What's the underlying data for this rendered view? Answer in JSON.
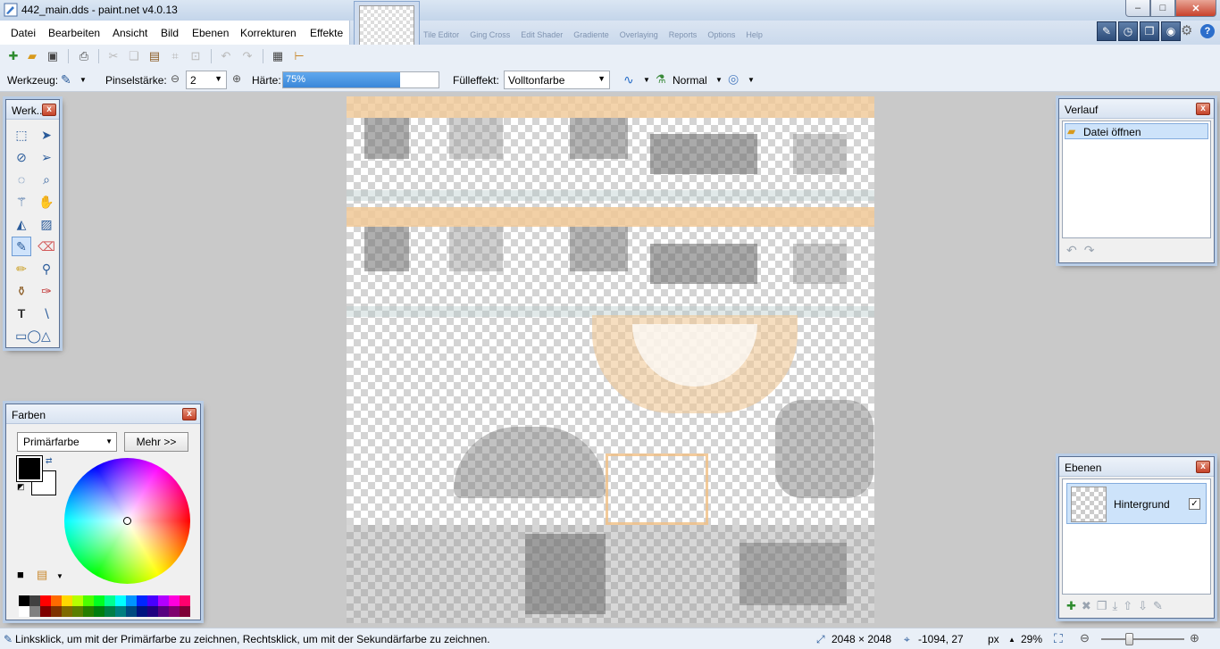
{
  "window": {
    "title": "442_main.dds - paint.net v4.0.13",
    "minimize": "–",
    "maximize": "□",
    "close": "✕"
  },
  "menu": [
    "Datei",
    "Bearbeiten",
    "Ansicht",
    "Bild",
    "Ebenen",
    "Korrekturen",
    "Effekte"
  ],
  "faded_menu": [
    "Tile Editor",
    "Ging Cross",
    "Edit Shader",
    "Gradiente",
    "Overlaying",
    "Reports",
    "Options",
    "Help"
  ],
  "toolbar": {
    "icons": [
      "new-icon",
      "open-icon",
      "save-icon",
      "print-icon",
      "cut-icon",
      "copy-icon",
      "paste-icon",
      "crop-icon",
      "deselect-icon",
      "undo-icon",
      "redo-icon",
      "grid-icon",
      "ruler-icon"
    ]
  },
  "options": {
    "tool_label": "Werkzeug:",
    "brush_width_label": "Pinselstärke:",
    "brush_width_value": "2",
    "hardness_label": "Härte:",
    "hardness_value": "75%",
    "hardness_fraction": 0.75,
    "fill_label": "Fülleffekt:",
    "fill_value": "Volltonfarbe",
    "blend_value": "Normal"
  },
  "tools_panel": {
    "title": "Werk...",
    "close": "x",
    "tools": [
      "rectangle-select",
      "move-selected",
      "lasso-select",
      "move-selection",
      "ellipse-select",
      "zoom",
      "magic-wand",
      "pan",
      "paint-bucket",
      "gradient",
      "paintbrush",
      "eraser",
      "pencil",
      "color-picker",
      "clone-stamp",
      "recolor",
      "text",
      "line-curve",
      "shapes"
    ]
  },
  "colors_panel": {
    "title": "Farben",
    "close": "x",
    "mode": "Primärfarbe",
    "more_button": "Mehr >>",
    "primary_color": "#000000",
    "secondary_color": "#ffffff",
    "palette": [
      "#000000",
      "#404040",
      "#ff0000",
      "#ff6a00",
      "#ffd800",
      "#b6ff00",
      "#4cff00",
      "#00ff21",
      "#00ff90",
      "#00ffff",
      "#0094ff",
      "#0026ff",
      "#4800ff",
      "#b200ff",
      "#ff00dc",
      "#ff006e",
      "#ffffff",
      "#808080",
      "#7f0000",
      "#7f3300",
      "#7f6a00",
      "#5b7f00",
      "#267f00",
      "#007f0e",
      "#007f46",
      "#007f7f",
      "#004a7f",
      "#00137f",
      "#21007f",
      "#57007f",
      "#7f006e",
      "#7f0037"
    ]
  },
  "history_panel": {
    "title": "Verlauf",
    "close": "x",
    "items": [
      "Datei öffnen"
    ]
  },
  "layers_panel": {
    "title": "Ebenen",
    "close": "x",
    "layers": [
      {
        "name": "Hintergrund",
        "visible": true
      }
    ]
  },
  "status": {
    "hint": "Linksklick, um mit der Primärfarbe zu zeichnen, Rechtsklick, um mit der Sekundärfarbe zu zeichnen.",
    "image_size": "2048 × 2048",
    "cursor_pos": "-1094, 27",
    "units": "px",
    "zoom": "29%"
  }
}
